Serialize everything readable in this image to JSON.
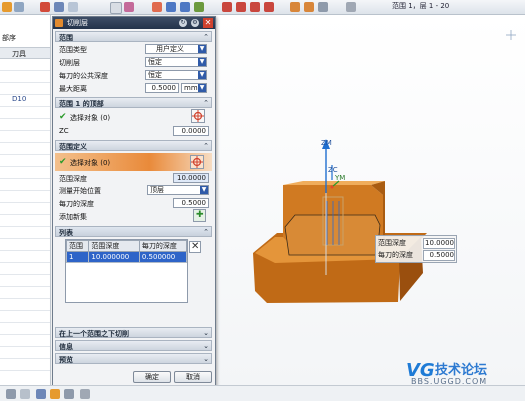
{
  "toolbar": {
    "status": "范围 1，层 1 - 20"
  },
  "navigator": {
    "header": "部序",
    "column": "刀具",
    "row_value": "D10"
  },
  "dialog": {
    "title": "切削层",
    "sec_range": "范围",
    "range_type_label": "范围类型",
    "range_type_value": "用户定义",
    "cut_levels_label": "切削层",
    "cut_levels_value": "恒定",
    "common_depth_label": "每刀的公共深度",
    "common_depth_value": "恒定",
    "max_distance_label": "最大距离",
    "max_distance_value": "0.5000",
    "max_distance_unit": "mm",
    "sec_range1_top": "范围 1 的顶部",
    "select_object": "选择对象 (0)",
    "zc_label": "ZC",
    "zc_value": "0.0000",
    "sec_range_def": "范围定义",
    "select_object_active": "选择对象 (0)",
    "range_depth_label": "范围深度",
    "range_depth_value": "10.0000",
    "measure_from_label": "测量开始位置",
    "measure_from_value": "顶层",
    "per_cut_depth_label": "每刀的深度",
    "per_cut_depth_value": "0.5000",
    "add_range_label": "添加新集",
    "list_header": "列表",
    "list_columns": [
      "范围",
      "范围深度",
      "每刀的深度"
    ],
    "list_rows": [
      [
        "1",
        "10.000000",
        "0.500000"
      ]
    ],
    "sec_cut_below": "在上一个范围之下切削",
    "sec_info": "信息",
    "sec_preview": "预览",
    "ok": "确定",
    "cancel": "取消"
  },
  "popup": {
    "range_depth_label": "范围深度",
    "range_depth_value": "10.0000",
    "per_cut_label": "每刀的深度",
    "per_cut_value": "0.5000"
  },
  "axes": {
    "zm": "ZM",
    "zc": "ZC",
    "ym": "YM"
  },
  "watermark": {
    "logo": "VG",
    "brand": "技术论坛",
    "url": "BBS.UGGD.COM"
  },
  "colors": {
    "title_bar": "#23324a",
    "accent_orange": "#e27a24",
    "part_orange": "#c8741e",
    "selected_row": "#2e64c8"
  }
}
